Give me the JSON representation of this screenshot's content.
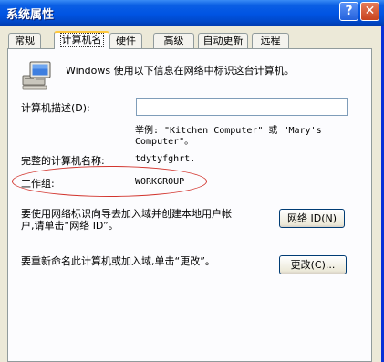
{
  "window": {
    "title": "系统属性"
  },
  "titlebar": {
    "help_glyph": "?",
    "close_glyph": "✕"
  },
  "tabs": [
    {
      "label": "常规"
    },
    {
      "label": "计算机名"
    },
    {
      "label": "硬件"
    },
    {
      "label": "高级"
    },
    {
      "label": "自动更新"
    },
    {
      "label": "远程"
    }
  ],
  "content": {
    "intro": "Windows 使用以下信息在网络中标识这台计算机。",
    "desc_label": "计算机描述(D):",
    "desc_value": "",
    "example_line1": "举例: \"Kitchen Computer\" 或 \"Mary's",
    "example_line2": "Computer\"。",
    "fullname_label": "完整的计算机名称:",
    "fullname_value": "tdytyfghrt.",
    "workgroup_label": "工作组:",
    "workgroup_value": "WORKGROUP",
    "network_text_line1": "要使用网络标识向导去加入域并创建本地用户帐",
    "network_text_line2": "户,请单击“网络 ID”。",
    "network_button": "网络 ID(N)",
    "rename_text": "要重新命名此计算机或加入域,单击“更改”。",
    "change_button": "更改(C)..."
  },
  "colors": {
    "titlebar": "#0054e3",
    "annotation": "#d2352e",
    "active_tab_highlight": "#ffc83c"
  }
}
